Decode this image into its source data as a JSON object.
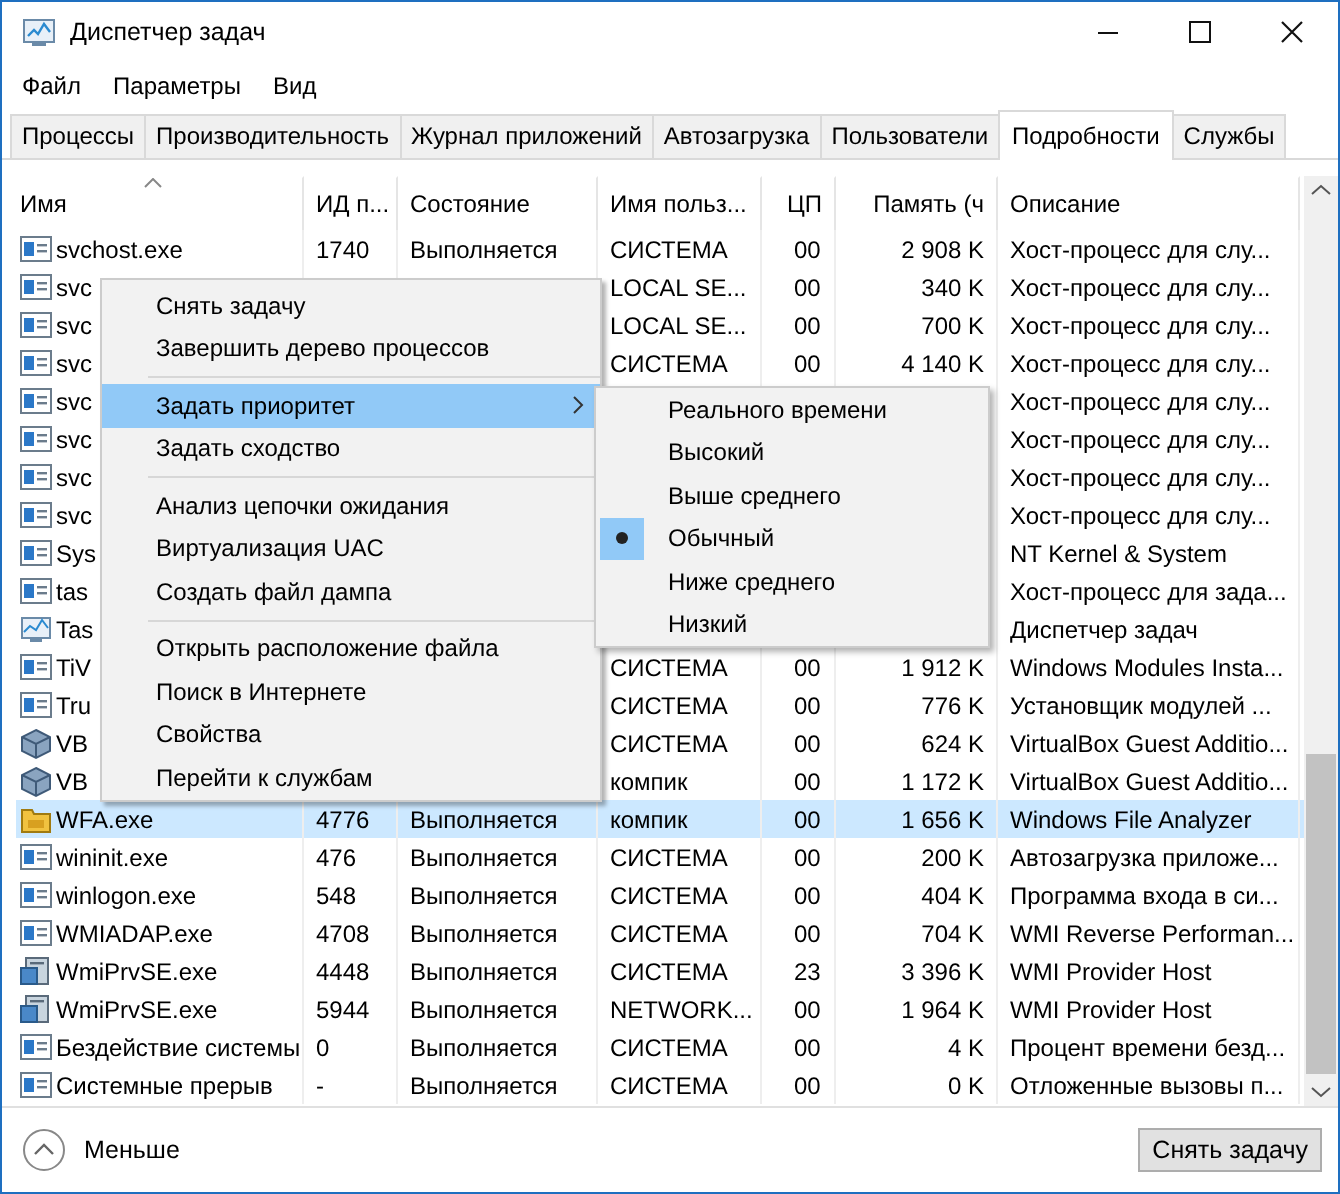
{
  "window": {
    "title": "Диспетчер задач"
  },
  "menu_bar": [
    "Файл",
    "Параметры",
    "Вид"
  ],
  "tabs": [
    {
      "label": "Процессы",
      "selected": false
    },
    {
      "label": "Производительность",
      "selected": false
    },
    {
      "label": "Журнал приложений",
      "selected": false
    },
    {
      "label": "Автозагрузка",
      "selected": false
    },
    {
      "label": "Пользователи",
      "selected": false
    },
    {
      "label": "Подробности",
      "selected": true
    },
    {
      "label": "Службы",
      "selected": false
    }
  ],
  "table": {
    "columns": [
      {
        "label": "Имя",
        "sorted": true
      },
      {
        "label": "ИД п...",
        "sorted": false
      },
      {
        "label": "Состояние",
        "sorted": false
      },
      {
        "label": "Имя польз...",
        "sorted": false
      },
      {
        "label": "ЦП",
        "sorted": false
      },
      {
        "label": "Память (ч",
        "sorted": false
      },
      {
        "label": "Описание",
        "sorted": false
      }
    ],
    "rows": [
      {
        "kind": "app",
        "selected": false,
        "cells": [
          "svchost.exe",
          "1740",
          "Выполняется",
          "СИСТЕМА",
          "00",
          "2 908 K",
          "Хост-процесс для слу..."
        ]
      },
      {
        "kind": "app",
        "selected": false,
        "cells": [
          "svc",
          null,
          null,
          "LOCAL SE...",
          "00",
          "340 K",
          "Хост-процесс для слу..."
        ]
      },
      {
        "kind": "app",
        "selected": false,
        "cells": [
          "svc",
          null,
          null,
          "LOCAL SE...",
          "00",
          "700 K",
          "Хост-процесс для слу..."
        ]
      },
      {
        "kind": "app",
        "selected": false,
        "cells": [
          "svc",
          null,
          null,
          "СИСТЕМА",
          "00",
          "4 140 K",
          "Хост-процесс для слу..."
        ]
      },
      {
        "kind": "app",
        "selected": false,
        "cells": [
          "svc",
          null,
          null,
          null,
          null,
          null,
          "Хост-процесс для слу..."
        ]
      },
      {
        "kind": "app",
        "selected": false,
        "cells": [
          "svc",
          null,
          null,
          null,
          null,
          null,
          "Хост-процесс для слу..."
        ]
      },
      {
        "kind": "app",
        "selected": false,
        "cells": [
          "svc",
          null,
          null,
          null,
          null,
          null,
          "Хост-процесс для слу..."
        ]
      },
      {
        "kind": "app",
        "selected": false,
        "cells": [
          "svc",
          null,
          null,
          null,
          null,
          null,
          "Хост-процесс для слу..."
        ]
      },
      {
        "kind": "app",
        "selected": false,
        "cells": [
          "Sys",
          null,
          null,
          null,
          null,
          null,
          "NT Kernel & System"
        ]
      },
      {
        "kind": "app",
        "selected": false,
        "cells": [
          "tas",
          null,
          null,
          null,
          null,
          null,
          "Хост-процесс для зада..."
        ]
      },
      {
        "kind": "monitor",
        "selected": false,
        "cells": [
          "Tas",
          null,
          null,
          null,
          null,
          null,
          "Диспетчер задач"
        ]
      },
      {
        "kind": "app",
        "selected": false,
        "cells": [
          "TiV",
          null,
          null,
          "СИСТЕМА",
          "00",
          "1 912 K",
          "Windows Modules Insta..."
        ]
      },
      {
        "kind": "app",
        "selected": false,
        "cells": [
          "Tru",
          null,
          null,
          "СИСТЕМА",
          "00",
          "776 K",
          "Установщик модулей ..."
        ]
      },
      {
        "kind": "cube",
        "selected": false,
        "cells": [
          "VB",
          null,
          null,
          "СИСТЕМА",
          "00",
          "624 K",
          "VirtualBox Guest Additio..."
        ]
      },
      {
        "kind": "cube",
        "selected": false,
        "cells": [
          "VB",
          null,
          null,
          "компик",
          "00",
          "1 172 K",
          "VirtualBox Guest Additio..."
        ]
      },
      {
        "kind": "folder",
        "selected": true,
        "cells": [
          "WFA.exe",
          "4776",
          "Выполняется",
          "компик",
          "00",
          "1 656 K",
          "Windows File Analyzer"
        ]
      },
      {
        "kind": "app",
        "selected": false,
        "cells": [
          "wininit.exe",
          "476",
          "Выполняется",
          "СИСТЕМА",
          "00",
          "200 K",
          "Автозагрузка приложе..."
        ]
      },
      {
        "kind": "app",
        "selected": false,
        "cells": [
          "winlogon.exe",
          "548",
          "Выполняется",
          "СИСТЕМА",
          "00",
          "404 K",
          "Программа входа в си..."
        ]
      },
      {
        "kind": "app",
        "selected": false,
        "cells": [
          "WMIADAP.exe",
          "4708",
          "Выполняется",
          "СИСТЕМА",
          "00",
          "704 K",
          "WMI Reverse Performan..."
        ]
      },
      {
        "kind": "server",
        "selected": false,
        "cells": [
          "WmiPrvSE.exe",
          "4448",
          "Выполняется",
          "СИСТЕМА",
          "23",
          "3 396 K",
          "WMI Provider Host"
        ]
      },
      {
        "kind": "server",
        "selected": false,
        "cells": [
          "WmiPrvSE.exe",
          "5944",
          "Выполняется",
          "NETWORK...",
          "00",
          "1 964 K",
          "WMI Provider Host"
        ]
      },
      {
        "kind": "app",
        "selected": false,
        "cells": [
          "Бездействие системы",
          "0",
          "Выполняется",
          "СИСТЕМА",
          "00",
          "4 K",
          "Процент времени безд..."
        ]
      },
      {
        "kind": "app",
        "selected": false,
        "cells": [
          "Системные прерыв",
          "-",
          "Выполняется",
          "СИСТЕМА",
          "00",
          "0 K",
          "Отложенные вызовы п..."
        ]
      }
    ]
  },
  "context_menu": {
    "items": [
      {
        "kind": "item",
        "label": "Снять задачу",
        "selected": false,
        "submenu": false
      },
      {
        "kind": "item",
        "label": "Завершить дерево процессов",
        "selected": false,
        "submenu": false
      },
      {
        "kind": "separator"
      },
      {
        "kind": "item",
        "label": "Задать приоритет",
        "selected": true,
        "submenu": true
      },
      {
        "kind": "item",
        "label": "Задать сходство",
        "selected": false,
        "submenu": false
      },
      {
        "kind": "separator"
      },
      {
        "kind": "item",
        "label": "Анализ цепочки ожидания",
        "selected": false,
        "submenu": false
      },
      {
        "kind": "item",
        "label": "Виртуализация UAC",
        "selected": false,
        "submenu": false
      },
      {
        "kind": "item",
        "label": "Создать файл дампа",
        "selected": false,
        "submenu": false
      },
      {
        "kind": "separator"
      },
      {
        "kind": "item",
        "label": "Открыть расположение файла",
        "selected": false,
        "submenu": false
      },
      {
        "kind": "item",
        "label": "Поиск в Интернете",
        "selected": false,
        "submenu": false
      },
      {
        "kind": "item",
        "label": "Свойства",
        "selected": false,
        "submenu": false
      },
      {
        "kind": "item",
        "label": "Перейти к службам",
        "selected": false,
        "submenu": false
      }
    ]
  },
  "priority_submenu": {
    "items": [
      {
        "label": "Реального времени",
        "selected": false
      },
      {
        "label": "Высокий",
        "selected": false
      },
      {
        "label": "Выше среднего",
        "selected": false
      },
      {
        "label": "Обычный",
        "selected": true
      },
      {
        "label": "Ниже среднего",
        "selected": false
      },
      {
        "label": "Низкий",
        "selected": false
      }
    ]
  },
  "footer": {
    "toggle_label": "Меньше",
    "end_task_button": "Снять задачу"
  }
}
